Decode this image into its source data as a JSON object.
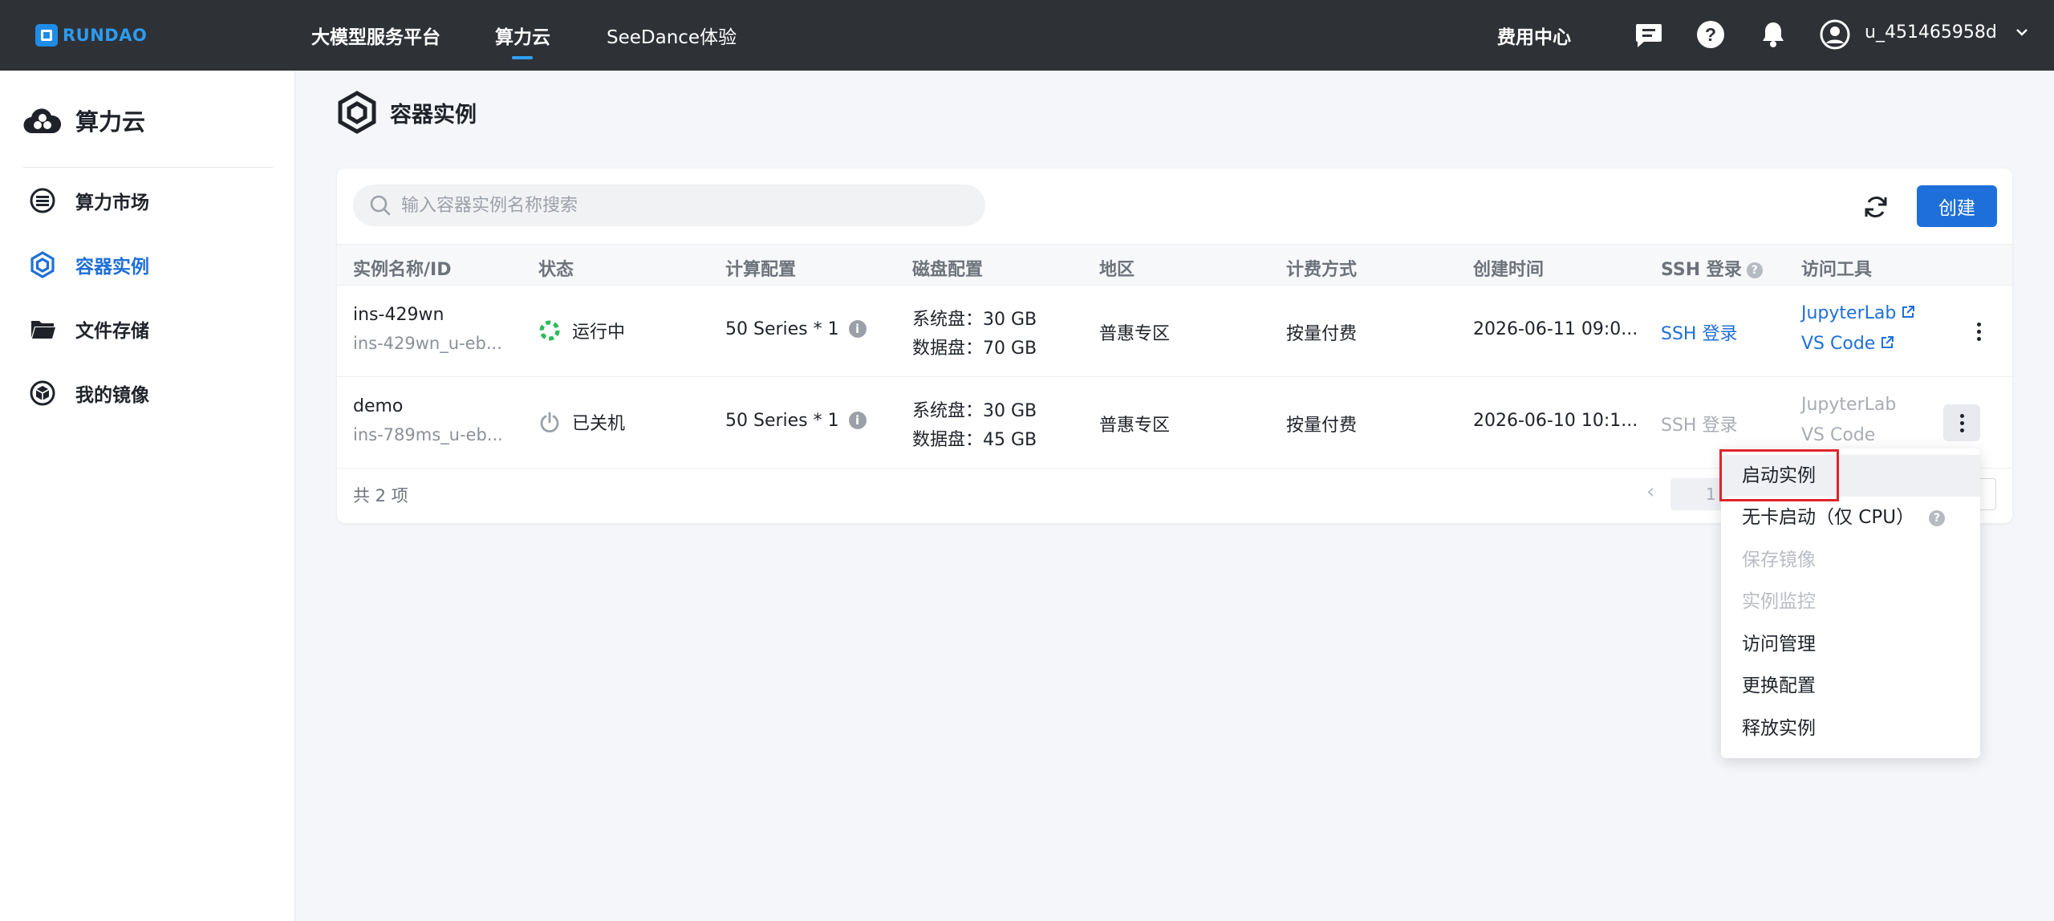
{
  "topbar": {
    "logo_text": "RUNDAO",
    "nav": [
      "大模型服务平台",
      "算力云",
      "SeeDance体验"
    ],
    "active_nav": "算力云",
    "billing": "费用中心",
    "icons": [
      "message-icon",
      "help-icon",
      "bell-icon",
      "user-avatar-icon",
      "chevron-down-icon"
    ],
    "username": "u_451465958d"
  },
  "sidebar": {
    "title": "算力云",
    "items": [
      {
        "label": "算力市场",
        "icon": "market-icon",
        "active": false
      },
      {
        "label": "容器实例",
        "icon": "container-icon",
        "active": true
      },
      {
        "label": "文件存储",
        "icon": "folder-icon",
        "active": false
      },
      {
        "label": "我的镜像",
        "icon": "image-icon",
        "active": false
      }
    ]
  },
  "page": {
    "title": "容器实例"
  },
  "toolbar": {
    "search_placeholder": "输入容器实例名称搜索",
    "create_label": "创建"
  },
  "table": {
    "headers": [
      "实例名称/ID",
      "状态",
      "计算配置",
      "磁盘配置",
      "地区",
      "计费方式",
      "创建时间",
      "SSH 登录",
      "访问工具"
    ],
    "rows": [
      {
        "name": "ins-429wn",
        "id": "ins-429wn_u-eb...",
        "status": "运行中",
        "status_color": "#2dbb5a",
        "compute": "50 Series * 1",
        "disk_system": "系统盘：30 GB",
        "disk_data": "数据盘：70 GB",
        "region": "普惠专区",
        "billing": "按量付费",
        "created": "2026-06-11 09:0...",
        "ssh": "SSH 登录",
        "tool1": "JupyterLab",
        "tool2": "VS Code"
      },
      {
        "name": "demo",
        "id": "ins-789ms_u-eb...",
        "status": "已关机",
        "status_color": "#9ba0a8",
        "compute": "50 Series * 1",
        "disk_system": "系统盘：30 GB",
        "disk_data": "数据盘：45 GB",
        "region": "普惠专区",
        "billing": "按量付费",
        "created": "2026-06-10 10:1...",
        "ssh": "SSH 登录",
        "tool1": "JupyterLab",
        "tool2": "VS Code"
      }
    ],
    "total": "共 2 项",
    "page_number": "1"
  },
  "menu": {
    "items": [
      {
        "label": "启动实例",
        "disabled": false
      },
      {
        "label": "无卡启动（仅 CPU）",
        "disabled": false
      },
      {
        "label": "保存镜像",
        "disabled": true
      },
      {
        "label": "实例监控",
        "disabled": true
      },
      {
        "label": "访问管理",
        "disabled": false
      },
      {
        "label": "更换配置",
        "disabled": false
      },
      {
        "label": "释放实例",
        "disabled": false
      }
    ]
  },
  "colors": {
    "accent": "#1e6fd9",
    "topbar": "#2e3136",
    "highlight_border": "#e0242a"
  }
}
